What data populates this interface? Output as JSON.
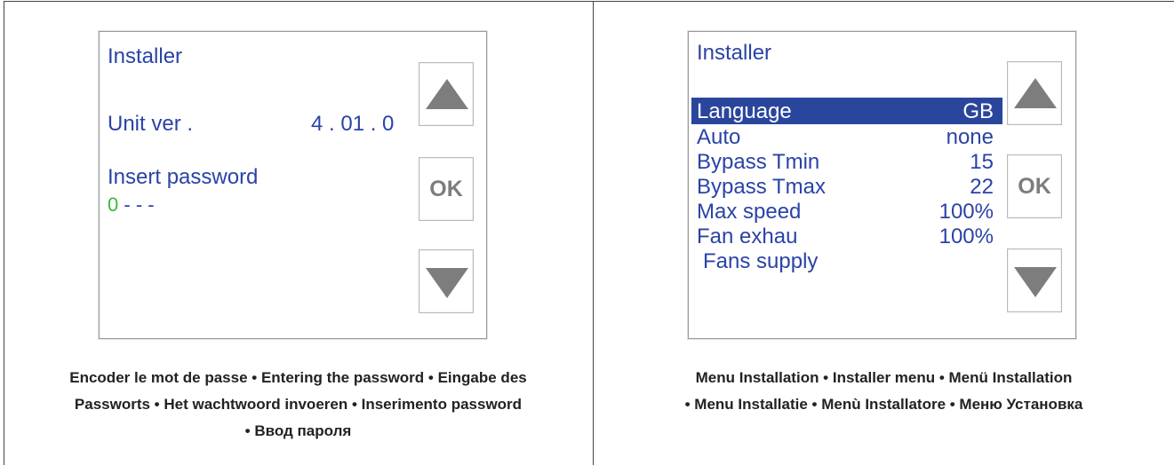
{
  "left_screen": {
    "title": "Installer",
    "unit_label": "Unit ver .",
    "unit_value": "4 . 01 . 0",
    "password_label": "Insert password",
    "password_digit": "0",
    "password_rest": "- - -",
    "btn_ok": "OK",
    "digit_color": "#3fb83a"
  },
  "right_screen": {
    "title": "Installer",
    "rows": [
      {
        "label": "Language",
        "value": "GB",
        "selected": true
      },
      {
        "label": "Auto",
        "value": "none"
      },
      {
        "label": "Bypass  Tmin",
        "value": "15"
      },
      {
        "label": "Bypass  Tmax",
        "value": "22"
      },
      {
        "label": "Max  speed",
        "value": "100%"
      },
      {
        "label": "Fan  exhau",
        "value": "100%"
      },
      {
        "label": "Fans supply",
        "value": ""
      }
    ],
    "btn_ok": "OK"
  },
  "captions": {
    "left_line1": "Encoder le mot de passe • Entering the password • Eingabe des",
    "left_line2": "Passworts • Het wachtwoord invoeren • Inserimento password",
    "left_line3": "• Ввод пароля",
    "right_line1": "Menu Installation • Installer menu • Menü Installation",
    "right_line2": "• Menu Installatie • Menù Installatore • Меню Установка"
  },
  "colors": {
    "screen_text": "#2a43a6",
    "selection_bg": "#2a469c",
    "button_glyph": "#7d7d7d"
  }
}
